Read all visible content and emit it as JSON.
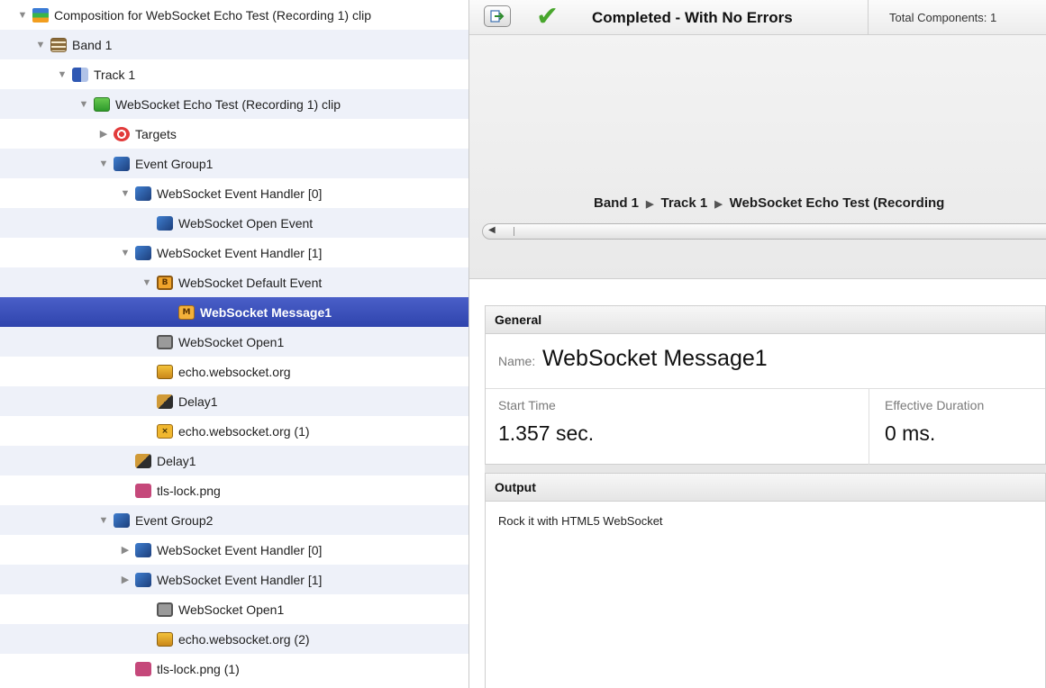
{
  "tree": [
    {
      "label": "Composition for WebSocket Echo Test (Recording 1) clip",
      "icon": "composition-icon",
      "expander": "expanded"
    },
    {
      "label": "Band 1",
      "icon": "band-icon",
      "expander": "expanded"
    },
    {
      "label": "Track 1",
      "icon": "track-icon",
      "expander": "expanded"
    },
    {
      "label": "WebSocket Echo Test (Recording 1) clip",
      "icon": "clip-icon",
      "expander": "expanded"
    },
    {
      "label": "Targets",
      "icon": "targets-icon",
      "expander": "collapsed"
    },
    {
      "label": "Event Group1",
      "icon": "event-group-icon",
      "expander": "expanded"
    },
    {
      "label": "WebSocket Event Handler [0]",
      "icon": "event-handler-icon",
      "expander": "expanded"
    },
    {
      "label": "WebSocket Open Event",
      "icon": "event-handler-icon",
      "expander": "none"
    },
    {
      "label": "WebSocket Event Handler [1]",
      "icon": "event-handler-icon",
      "expander": "expanded"
    },
    {
      "label": "WebSocket Default Event",
      "icon": "default-event-icon",
      "expander": "expanded"
    },
    {
      "label": "WebSocket Message1",
      "icon": "message-icon",
      "expander": "none",
      "selected": true
    },
    {
      "label": "WebSocket Open1",
      "icon": "websocket-open-icon",
      "expander": "none"
    },
    {
      "label": "echo.websocket.org",
      "icon": "connection-icon",
      "expander": "none"
    },
    {
      "label": "Delay1",
      "icon": "delay-icon",
      "expander": "none"
    },
    {
      "label": "echo.websocket.org (1)",
      "icon": "close-connection-icon",
      "expander": "none"
    },
    {
      "label": "Delay1",
      "icon": "delay-icon",
      "expander": "none"
    },
    {
      "label": "tls-lock.png",
      "icon": "image-icon",
      "expander": "none"
    },
    {
      "label": "Event Group2",
      "icon": "event-group-icon",
      "expander": "expanded"
    },
    {
      "label": "WebSocket Event Handler [0]",
      "icon": "event-handler-icon",
      "expander": "collapsed"
    },
    {
      "label": "WebSocket Event Handler [1]",
      "icon": "event-handler-icon",
      "expander": "collapsed"
    },
    {
      "label": "WebSocket Open1",
      "icon": "websocket-open-icon",
      "expander": "none"
    },
    {
      "label": "echo.websocket.org (2)",
      "icon": "connection-icon",
      "expander": "none"
    },
    {
      "label": "tls-lock.png (1)",
      "icon": "image-icon",
      "expander": "none"
    }
  ],
  "status": {
    "text": "Completed - With No Errors",
    "total_label": "Total Components: 1"
  },
  "breadcrumb": [
    "Band 1",
    "Track 1",
    "WebSocket Echo Test (Recording"
  ],
  "general": {
    "header": "General",
    "name_label": "Name:",
    "name_value": "WebSocket Message1",
    "start_label": "Start Time",
    "start_value": "1.357 sec.",
    "duration_label": "Effective Duration",
    "duration_value": "0 ms."
  },
  "output": {
    "header": "Output",
    "text": "Rock it with HTML5 WebSocket"
  },
  "colors": {
    "selection": "#3a4fbd",
    "success_check": "#48a62c",
    "alt_row": "#eef1f9"
  }
}
